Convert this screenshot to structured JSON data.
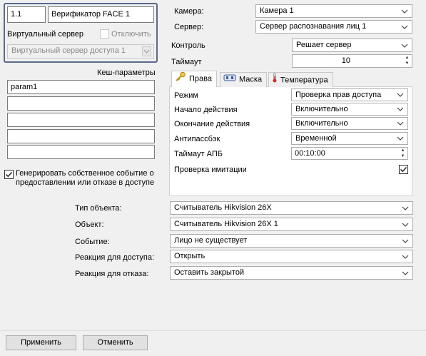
{
  "header": {
    "id_value": "1.1",
    "name_value": "Верификатор FACE 1",
    "virtual_server_label": "Виртуальный сервер",
    "disable_label": "Отключить",
    "virtual_server_select": "Виртуальный сервер доступа 1"
  },
  "cache": {
    "title": "Кеш-параметры",
    "rows": [
      "param1",
      "",
      "",
      "",
      ""
    ]
  },
  "generate_event": {
    "checked": true,
    "label_line1": "Генерировать собственное событие о",
    "label_line2": "предоставлении или отказе в доступе"
  },
  "top_fields": {
    "camera_label": "Камера:",
    "camera_value": "Камера 1",
    "server_label": "Сервер:",
    "server_value": "Сервер распознавания лиц 1",
    "control_label": "Контроль",
    "control_value": "Решает сервер",
    "timeout_label": "Таймаут",
    "timeout_value": "10"
  },
  "tabs": [
    {
      "label": "Права",
      "icon": "key-icon",
      "active": true
    },
    {
      "label": "Маска",
      "icon": "mask-icon",
      "active": false
    },
    {
      "label": "Температура",
      "icon": "thermometer-icon",
      "active": false
    }
  ],
  "rights": {
    "mode_label": "Режим",
    "mode_value": "Проверка прав доступа",
    "start_label": "Начало действия",
    "start_value": "Включительно",
    "end_label": "Окончание действия",
    "end_value": "Включительно",
    "antipassback_label": "Антипассбэк",
    "antipassback_value": "Временной",
    "apb_timeout_label": "Таймаут АПБ",
    "apb_timeout_value": "00:10:00",
    "imitation_label": "Проверка имитации",
    "imitation_checked": true
  },
  "bottom_fields": {
    "object_type_label": "Тип объекта:",
    "object_type_value": "Считыватель Hikvision 26X",
    "object_label": "Объект:",
    "object_value": "Считыватель Hikvision 26X 1",
    "event_label": "Событие:",
    "event_value": "Лицо не существует",
    "access_reaction_label": "Реакция для доступа:",
    "access_reaction_value": "Открыть",
    "deny_reaction_label": "Реакция для отказа:",
    "deny_reaction_value": "Оставить закрытой"
  },
  "buttons": {
    "apply": "Применить",
    "cancel": "Отменить"
  }
}
